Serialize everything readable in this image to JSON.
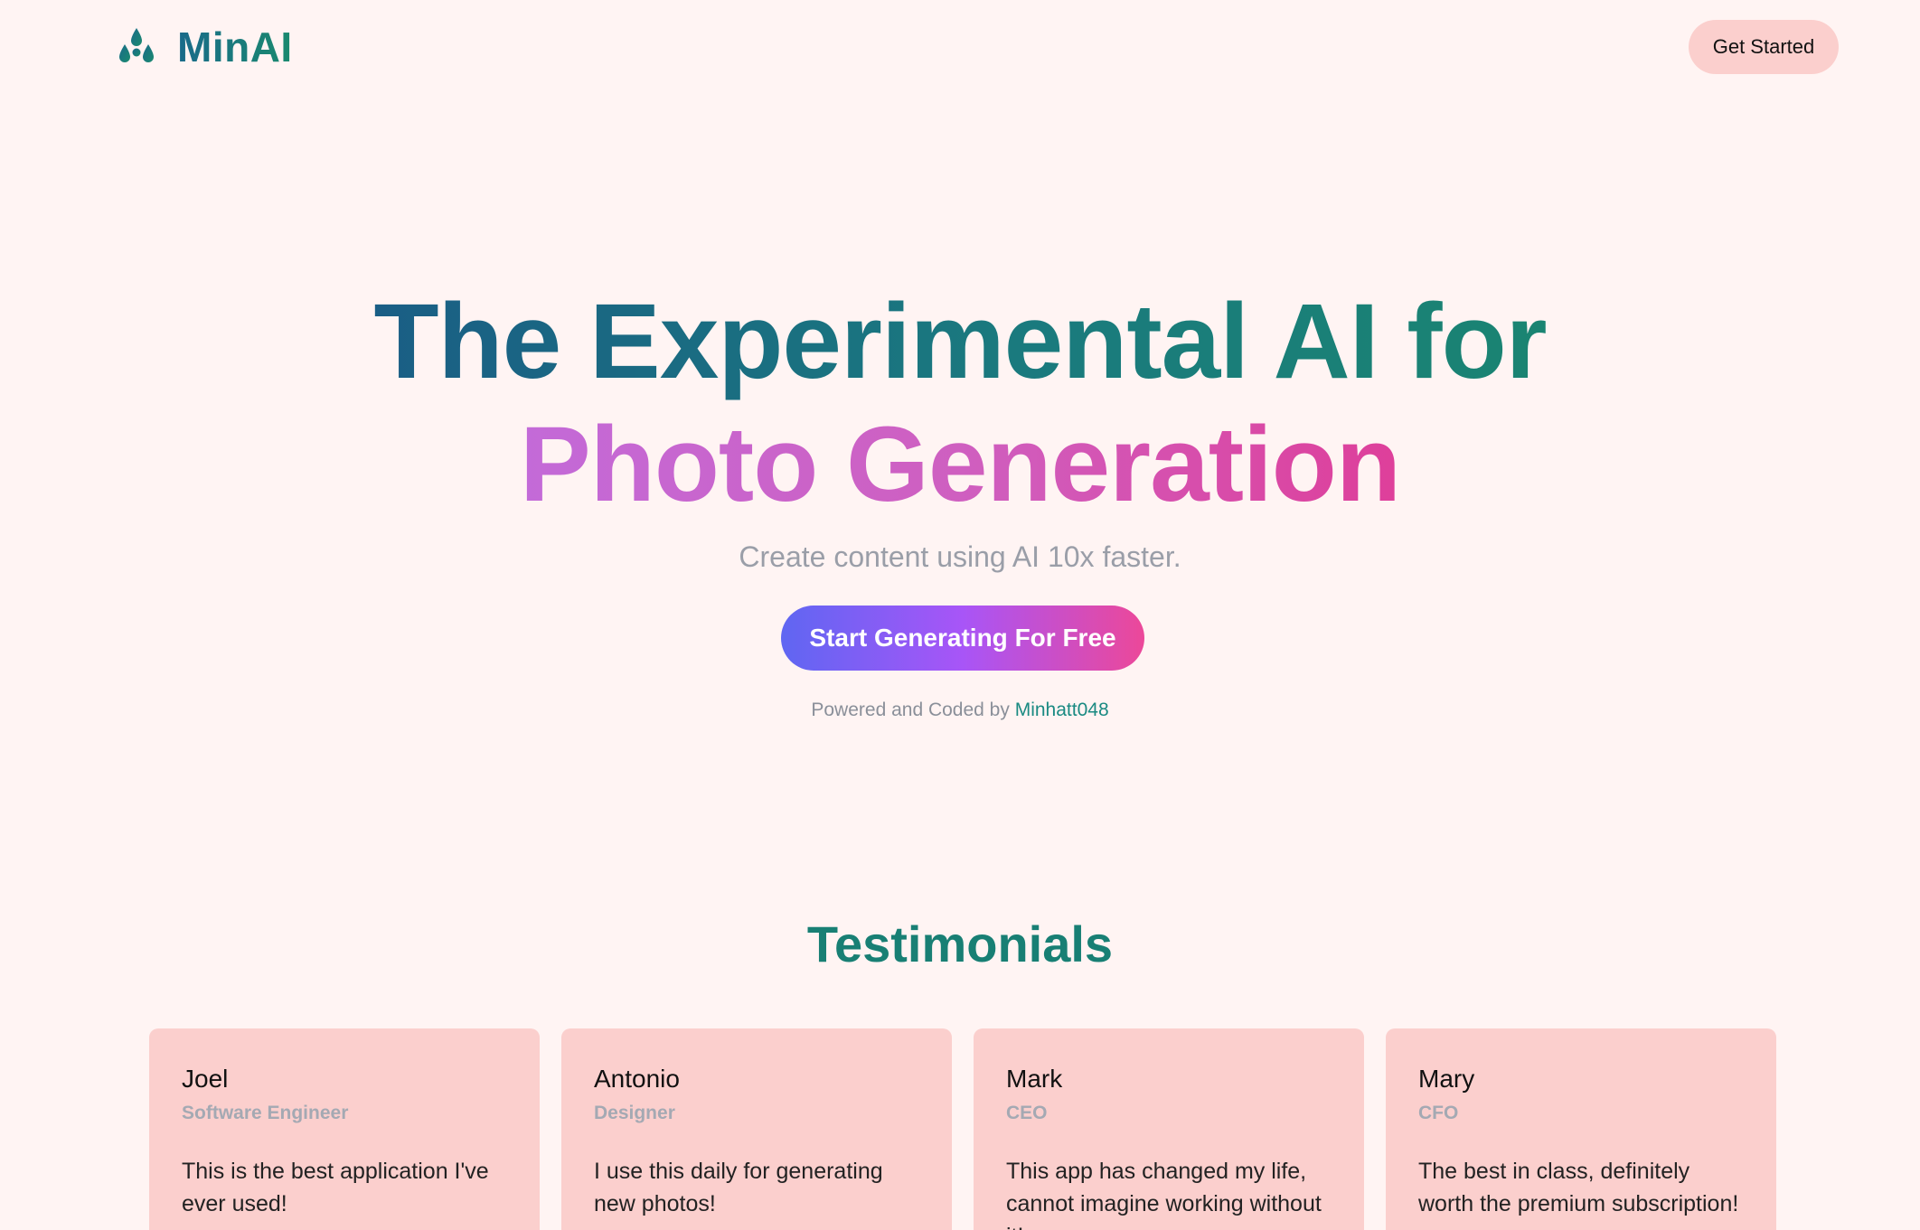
{
  "header": {
    "brand_name": "MinAI",
    "logo_icon": "droplets-icon",
    "get_started_label": "Get Started"
  },
  "hero": {
    "line1": "The Experimental AI for",
    "line2": "Photo Generation",
    "subtitle": "Create content using AI 10x faster.",
    "cta_label": "Start Generating For Free",
    "powered_prefix": "Powered and Coded by",
    "powered_link": "Minhatt048"
  },
  "testimonials": {
    "title": "Testimonials",
    "items": [
      {
        "name": "Joel",
        "role": "Software Engineer",
        "text": "This is the best application I've ever used!"
      },
      {
        "name": "Antonio",
        "role": "Designer",
        "text": "I use this daily for generating new photos!"
      },
      {
        "name": "Mark",
        "role": "CEO",
        "text": "This app has changed my life, cannot imagine working without it!"
      },
      {
        "name": "Mary",
        "role": "CFO",
        "text": "The best in class, definitely worth the premium subscription!"
      }
    ]
  },
  "colors": {
    "background": "#fff4f3",
    "accent_teal": "#1a7f7b",
    "card_pink": "#fbcfcd",
    "cta_gradient": [
      "#5f66f2",
      "#a855f7",
      "#ec4899"
    ]
  }
}
